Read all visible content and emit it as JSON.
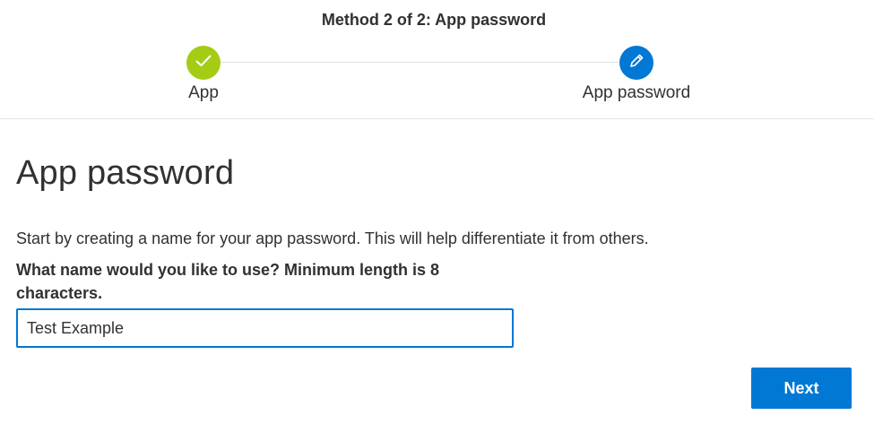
{
  "header": {
    "method_title": "Method 2 of 2: App password",
    "steps": [
      {
        "label": "App",
        "status": "complete",
        "icon": "checkmark-icon",
        "color": "#a4cc14"
      },
      {
        "label": "App password",
        "status": "current",
        "icon": "pencil-icon",
        "color": "#0078d4"
      }
    ]
  },
  "main": {
    "title": "App password",
    "description": "Start by creating a name for your app password. This will help differentiate it from others.",
    "field_label": "What name would you like to use? Minimum length is 8 characters.",
    "name_input": {
      "value": "Test Example",
      "placeholder": ""
    },
    "next_label": "Next"
  },
  "colors": {
    "accent": "#0078d4",
    "complete": "#a4cc14"
  }
}
